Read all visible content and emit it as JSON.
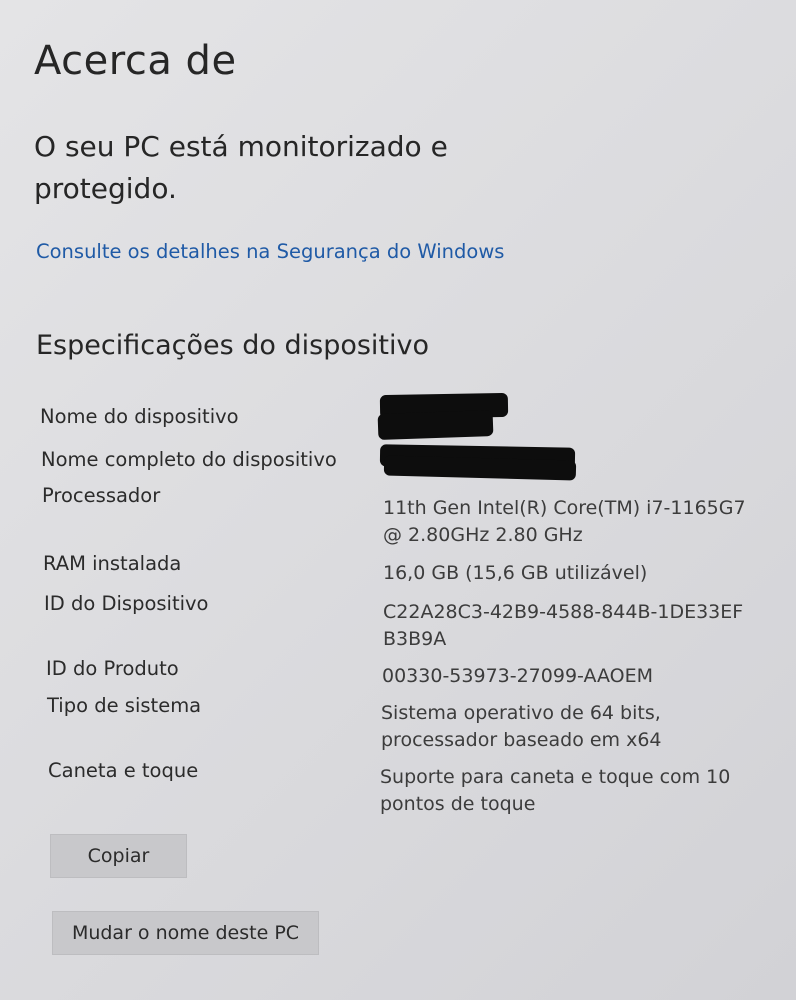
{
  "page": {
    "title": "Acerca de"
  },
  "protection": {
    "status_line1": "O seu PC está monitorizado e",
    "status_line2": "protegido.",
    "link_label": "Consulte os detalhes na Segurança do Windows"
  },
  "device_specs": {
    "heading": "Especificações do dispositivo",
    "device_name_label": "Nome do dispositivo",
    "full_device_name_label": "Nome completo do dispositivo",
    "processor_label": "Processador",
    "processor_value_line1": "11th Gen Intel(R) Core(TM) i7-1165G7",
    "processor_value_line2": "@ 2.80GHz   2.80 GHz",
    "ram_label": "RAM instalada",
    "ram_value": "16,0 GB (15,6 GB utilizável)",
    "device_id_label": "ID do Dispositivo",
    "device_id_value_line1": "C22A28C3-42B9-4588-844B-1DE33EF",
    "device_id_value_line2": "B3B9A",
    "product_id_label": "ID do Produto",
    "product_id_value": "00330-53973-27099-AAOEM",
    "system_type_label": "Tipo de sistema",
    "system_type_value_line1": "Sistema operativo de 64 bits,",
    "system_type_value_line2": "processador baseado em x64",
    "pen_touch_label": "Caneta e toque",
    "pen_touch_value_line1": "Suporte para caneta e toque com 10",
    "pen_touch_value_line2": "pontos de toque"
  },
  "actions": {
    "copy_label": "Copiar",
    "rename_label": "Mudar o nome deste PC"
  },
  "colors": {
    "link": "#1f5aa6",
    "button_bg": "#c8c8cb",
    "background": "#dcdcdf"
  }
}
